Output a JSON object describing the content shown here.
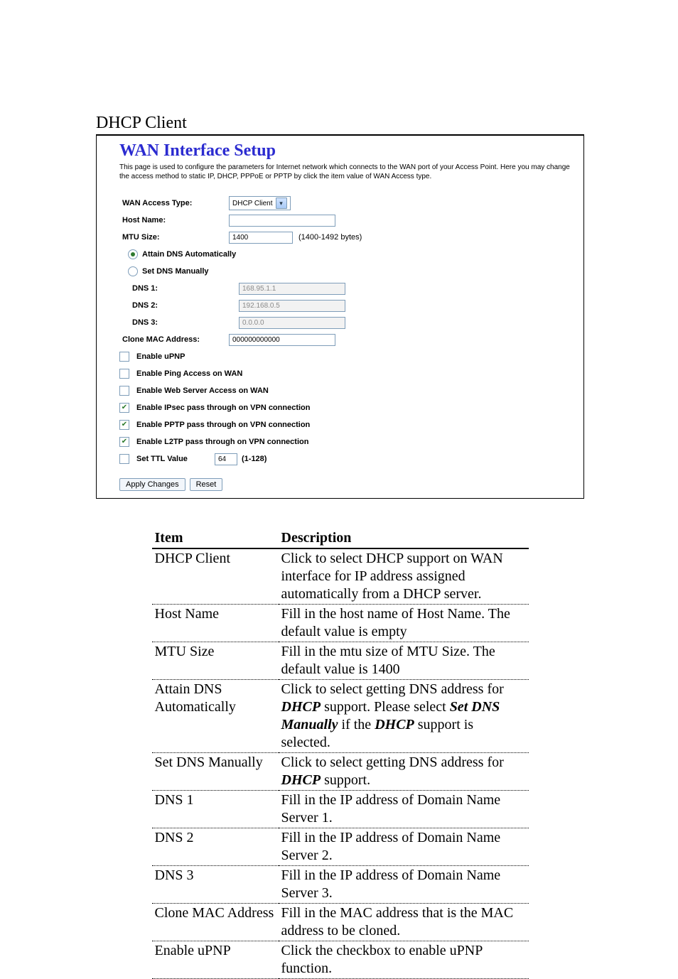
{
  "section_title": "DHCP Client",
  "router": {
    "title": "WAN Interface Setup",
    "intro": "This page is used to configure the parameters for Internet network which connects to the WAN port of your Access Point. Here you may change the access method to static IP, DHCP, PPPoE or PPTP by click the item value of WAN Access type.",
    "labels": {
      "wan_access_type": "WAN Access Type:",
      "host_name": "Host Name:",
      "mtu_size": "MTU Size:",
      "attain_dns": "Attain DNS Automatically",
      "set_dns": "Set DNS Manually",
      "dns1": "DNS 1:",
      "dns2": "DNS 2:",
      "dns3": "DNS 3:",
      "clone_mac": "Clone MAC Address:",
      "enable_upnp": "Enable uPNP",
      "enable_ping": "Enable Ping Access on WAN",
      "enable_web": "Enable Web Server Access on WAN",
      "enable_ipsec": "Enable IPsec pass through on VPN connection",
      "enable_pptp": "Enable PPTP pass through on VPN connection",
      "enable_l2tp": "Enable L2TP pass through on VPN connection",
      "set_ttl": "Set TTL Value"
    },
    "values": {
      "wan_access_type": "DHCP Client",
      "host_name": "",
      "mtu_size": "1400",
      "mtu_hint": "(1400-1492 bytes)",
      "dns1": "168.95.1.1",
      "dns2": "192.168.0.5",
      "dns3": "0.0.0.0",
      "clone_mac": "000000000000",
      "ttl": "64",
      "ttl_hint": "(1-128)"
    },
    "state": {
      "dns_mode": "auto",
      "enable_upnp": false,
      "enable_ping": false,
      "enable_web": false,
      "enable_ipsec": true,
      "enable_pptp": true,
      "enable_l2tp": true,
      "set_ttl": false
    },
    "buttons": {
      "apply": "Apply Changes",
      "reset": "Reset"
    }
  },
  "desc": {
    "header_item": "Item",
    "header_desc": "Description",
    "rows": [
      {
        "item": "DHCP Client",
        "desc": "Click to select DHCP support on WAN interface for IP address assigned automatically from a DHCP server."
      },
      {
        "item": "Host Name",
        "desc": "Fill in the host name of Host Name. The default value is empty"
      },
      {
        "item": "MTU Size",
        "desc": "Fill in the mtu size of MTU Size. The default value is 1400"
      },
      {
        "item": "Attain DNS Automatically",
        "desc_html": "Click to select getting DNS address for <b><i>DHCP</i></b> support. Please select <b><i>Set DNS Manually</i></b> if the <b><i>DHCP</i></b> support is selected."
      },
      {
        "item": "Set DNS Manually",
        "desc_html": "Click to select getting DNS address for <b><i>DHCP</i></b> support."
      },
      {
        "item": "DNS 1",
        "desc": "Fill in the IP address of Domain Name Server 1."
      },
      {
        "item": "DNS 2",
        "desc": "Fill in the IP address of Domain Name Server 2."
      },
      {
        "item": "DNS 3",
        "desc": "Fill in the IP address of Domain Name Server 3."
      },
      {
        "item": "Clone MAC Address",
        "desc": "Fill in the MAC address that is the MAC address to be cloned."
      },
      {
        "item": "Enable uPNP",
        "desc": "Click the checkbox to enable uPNP function."
      }
    ]
  }
}
